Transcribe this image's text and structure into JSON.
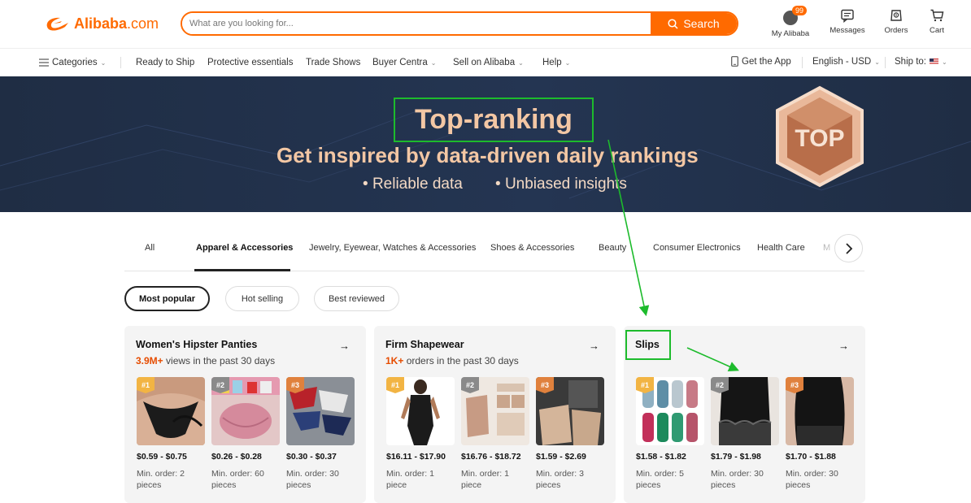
{
  "header": {
    "logo_brand": "Alibaba",
    "logo_suffix": ".com",
    "search_placeholder": "What are you looking for...",
    "search_button": "Search",
    "my_alibaba": "My Alibaba",
    "my_alibaba_badge": "99",
    "messages": "Messages",
    "orders": "Orders",
    "cart": "Cart"
  },
  "nav": {
    "categories": "Categories",
    "items": [
      "Ready to Ship",
      "Protective essentials",
      "Trade Shows",
      "Buyer Centra",
      "Sell on Alibaba",
      "Help"
    ],
    "get_app": "Get the App",
    "language": "English - USD",
    "ship_to": "Ship to:"
  },
  "banner": {
    "title": "Top-ranking",
    "subtitle": "Get inspired by data-driven daily rankings",
    "point_1": "Reliable data",
    "point_2": "Unbiased insights",
    "badge_text": "TOP"
  },
  "tabs": [
    "All",
    "Apparel & Accessories",
    "Jewelry, Eyewear, Watches & Accessories",
    "Shoes & Accessories",
    "Beauty",
    "Consumer Electronics",
    "Health Care",
    "M"
  ],
  "active_tab": "Apparel & Accessories",
  "filters": [
    "Most popular",
    "Hot selling",
    "Best reviewed"
  ],
  "active_filter": "Most popular",
  "cards": [
    {
      "title": "Women's Hipster Panties",
      "stat_value": "3.9M+",
      "stat_text": "views in the past 30 days",
      "products": [
        {
          "rank": "#1",
          "price": "$0.59 - $0.75",
          "moq": "Min. order: 2 pieces"
        },
        {
          "rank": "#2",
          "price": "$0.26 - $0.28",
          "moq": "Min. order: 60 pieces"
        },
        {
          "rank": "#3",
          "price": "$0.30 - $0.37",
          "moq": "Min. order: 30 pieces"
        }
      ]
    },
    {
      "title": "Firm Shapewear",
      "stat_value": "1K+",
      "stat_text": "orders in the past 30 days",
      "products": [
        {
          "rank": "#1",
          "price": "$16.11 - $17.90",
          "moq": "Min. order: 1 piece"
        },
        {
          "rank": "#2",
          "price": "$16.76 - $18.72",
          "moq": "Min. order: 1 piece"
        },
        {
          "rank": "#3",
          "price": "$1.59 - $2.69",
          "moq": "Min. order: 3 pieces"
        }
      ]
    },
    {
      "title": "Slips",
      "stat_value": "",
      "stat_text": "",
      "products": [
        {
          "rank": "#1",
          "price": "$1.58 - $1.82",
          "moq": "Min. order: 5 pieces"
        },
        {
          "rank": "#2",
          "price": "$1.79 - $1.98",
          "moq": "Min. order: 30 pieces"
        },
        {
          "rank": "#3",
          "price": "$1.70 - $1.88",
          "moq": "Min. order: 30 pieces"
        }
      ]
    }
  ],
  "colors": {
    "accent": "#ff6a00",
    "highlight_stat": "#e64c00",
    "annotation_green": "#1dbb2c",
    "banner_bg": "#1f2d44",
    "banner_text": "#f3c7a4"
  },
  "icons": {
    "search": "search-icon",
    "messages": "message-icon",
    "orders": "orders-icon",
    "cart": "cart-icon",
    "categories": "menu-icon",
    "app": "phone-icon",
    "next": "chevron-right-icon",
    "card_link": "arrow-right-icon"
  }
}
